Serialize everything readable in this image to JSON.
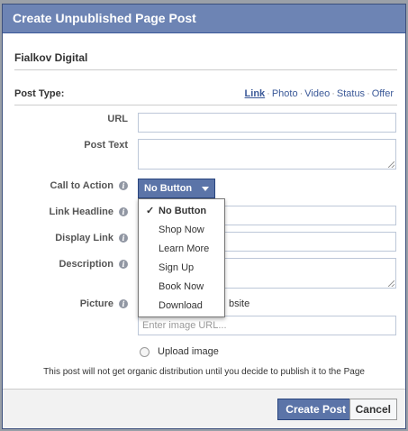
{
  "dialog": {
    "title": "Create Unpublished Page Post"
  },
  "page_name": "Fialkov Digital",
  "post_type": {
    "label": "Post Type:",
    "types": [
      "Link",
      "Photo",
      "Video",
      "Status",
      "Offer"
    ],
    "active": "Link"
  },
  "fields": {
    "url_label": "URL",
    "post_text_label": "Post Text",
    "cta_label": "Call to Action",
    "link_headline_label": "Link Headline",
    "display_link_label": "Display Link",
    "description_label": "Description",
    "picture_label": "Picture"
  },
  "cta": {
    "selected": "No Button",
    "options": [
      "No Button",
      "Shop Now",
      "Learn More",
      "Sign Up",
      "Book Now",
      "Download"
    ]
  },
  "picture": {
    "website_option_partial": "bsite",
    "image_url_placeholder": "Enter image URL...",
    "upload_label": "Upload image"
  },
  "notice": "This post will not get organic distribution until you decide to publish it to the Page",
  "footer": {
    "create_label": "Create Post",
    "cancel_label": "Cancel"
  },
  "colors": {
    "header_bg": "#6d84b4",
    "primary_button": "#5b74a8",
    "link": "#3b5998"
  }
}
